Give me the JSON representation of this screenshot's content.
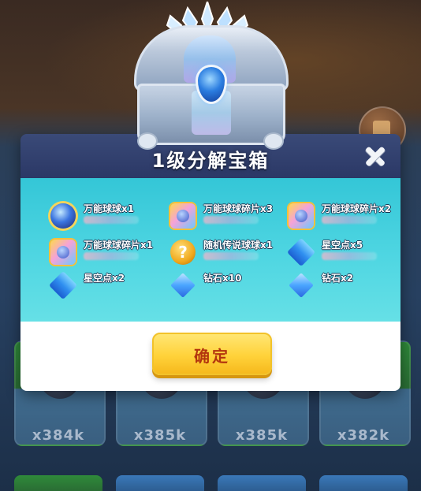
{
  "dialog": {
    "title": "1级分解宝箱",
    "confirm_label": "确定"
  },
  "rewards": [
    {
      "name": "万能球球x1",
      "icon": "universal-ball-icon"
    },
    {
      "name": "万能球球碎片x3",
      "icon": "ball-fragment-icon"
    },
    {
      "name": "万能球球碎片x2",
      "icon": "ball-fragment-icon"
    },
    {
      "name": "万能球球碎片x1",
      "icon": "ball-fragment-icon"
    },
    {
      "name": "随机传说球球x1",
      "icon": "mystery-ball-icon"
    },
    {
      "name": "星空点x5",
      "icon": "star-point-icon"
    },
    {
      "name": "星空点x2",
      "icon": "star-point-icon"
    },
    {
      "name": "钻石x10",
      "icon": "diamond-icon"
    },
    {
      "name": "钻石x2",
      "icon": "diamond-icon"
    }
  ],
  "background": {
    "counts": [
      "x384k",
      "x385k",
      "x385k",
      "x382k"
    ]
  },
  "colors": {
    "header": "#2f3c6c",
    "body": "#44cfdd",
    "button": "#ffd23a",
    "button_text": "#b3350e"
  }
}
